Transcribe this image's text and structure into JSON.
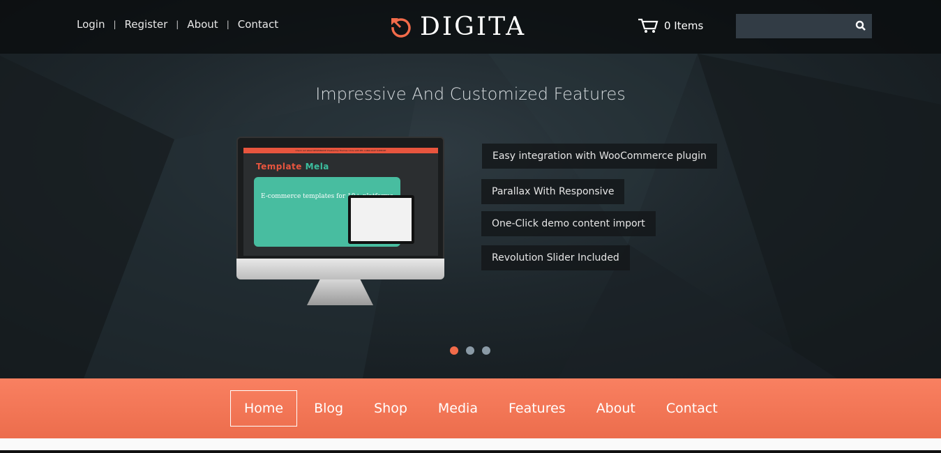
{
  "header": {
    "links": [
      "Login",
      "Register",
      "About",
      "Contact"
    ],
    "logo": "DIGITA",
    "cart_label": "0 Items",
    "search_placeholder": ""
  },
  "hero": {
    "headline": "Impressive And Customized Features",
    "features": [
      "Easy integration with WooCommerce plugin",
      "Parallax With Responsive",
      "One-Click demo content import",
      "Revolution Slider Included"
    ],
    "screen": {
      "logo_a": "Template",
      "logo_b": "Mela",
      "heading": "E-commerce templates for 10+ platforms",
      "banner": "Check out latest RESPONSIVE Prestashop Themes 1.6.& with RTL LANGUAGE SUPPORT"
    },
    "slides": 3,
    "active_slide": 1
  },
  "nav": {
    "items": [
      "Home",
      "Blog",
      "Shop",
      "Media",
      "Features",
      "About",
      "Contact"
    ],
    "active": "Home"
  },
  "colors": {
    "accent": "#f26b4a",
    "nav_top": "#f98061",
    "nav_bottom": "#ec6d4c"
  }
}
